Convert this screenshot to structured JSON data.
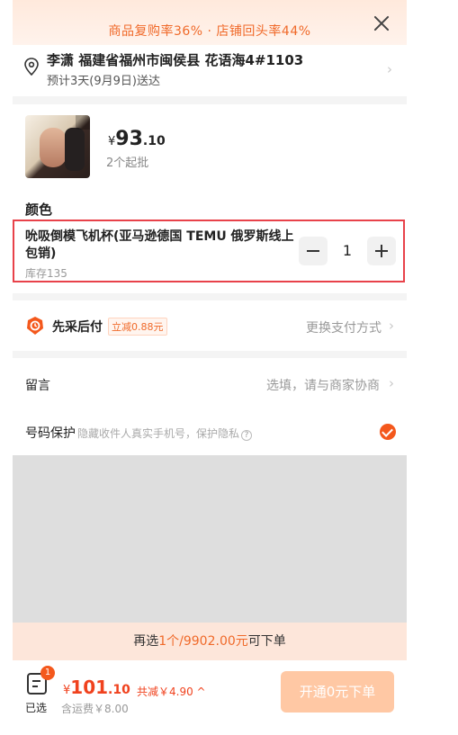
{
  "banner": {
    "text": "商品复购率36% · 店铺回头率44%"
  },
  "address": {
    "line": "李潇 福建省福州市闽侯县 花语海4#1103",
    "eta": "预计3天(9月9日)送达"
  },
  "product": {
    "price_symbol": "¥",
    "price_int": "93",
    "price_dec": ".10",
    "min_order": "2个起批",
    "color_label": "颜色",
    "variant": {
      "name": "吮吸倒模飞机杯(亚马逊德国 TEMU 俄罗斯线上 包销)",
      "stock": "库存135",
      "quantity": "1"
    }
  },
  "payment": {
    "label": "先采后付",
    "badge": "立减0.88元",
    "switch_label": "更换支付方式"
  },
  "remark": {
    "label": "留言",
    "placeholder": "选填，请与商家协商"
  },
  "privacy": {
    "label": "号码保护",
    "hint": "隐藏收件人真实手机号，保护隐私",
    "checked": true
  },
  "hint_bar": {
    "prefix": "再选",
    "count": "1个",
    "sep": "/",
    "amount": "9902.00元",
    "suffix": "可下单"
  },
  "footer": {
    "cart_count": "1",
    "selected_label": "已选",
    "total_symbol": "¥",
    "total_int": "101",
    "total_dec": ".10",
    "discount": "共减￥4.90 ^",
    "shipping": "含运费￥8.00",
    "submit_label": "开通0元下单"
  },
  "colors": {
    "accent": "#f4581c",
    "price_red": "#f0421e",
    "highlight_border": "#e8424a",
    "submit_disabled": "#ffc8a4"
  },
  "icons": [
    "close-icon",
    "location-icon",
    "chevron-right-icon",
    "pay-later-icon",
    "help-icon",
    "check-icon",
    "cart-icon"
  ]
}
